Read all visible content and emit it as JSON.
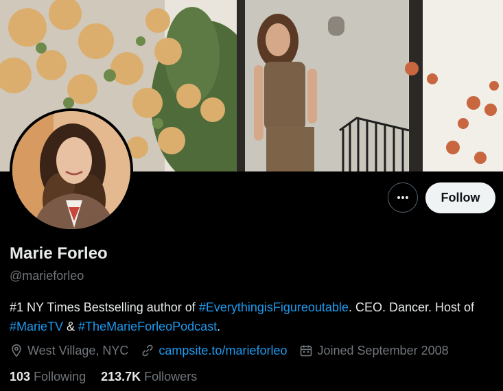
{
  "profile": {
    "name": "Marie Forleo",
    "handle": "@marieforleo",
    "bio": {
      "part1": "#1 NY Times Bestselling author of ",
      "hashtag1": "#EverythingisFigureoutable",
      "part2": ". CEO. Dancer. Host of ",
      "hashtag2": "#MarieTV",
      "part3": " & ",
      "hashtag3": "#TheMarieForleoPodcast",
      "part4": "."
    },
    "location": "West Village, NYC",
    "website": "campsite.to/marieforleo",
    "joined": "Joined September 2008",
    "following_count": "103",
    "following_label": "Following",
    "followers_count": "213.7K",
    "followers_label": "Followers"
  },
  "actions": {
    "follow_label": "Follow"
  },
  "icons": {
    "more": "more-horizontal-icon",
    "location": "location-pin-icon",
    "link": "link-icon",
    "calendar": "calendar-icon"
  },
  "colors": {
    "background": "#000000",
    "link": "#1d9bf0",
    "secondary_text": "#71767b",
    "follow_button": "#eff3f4"
  }
}
